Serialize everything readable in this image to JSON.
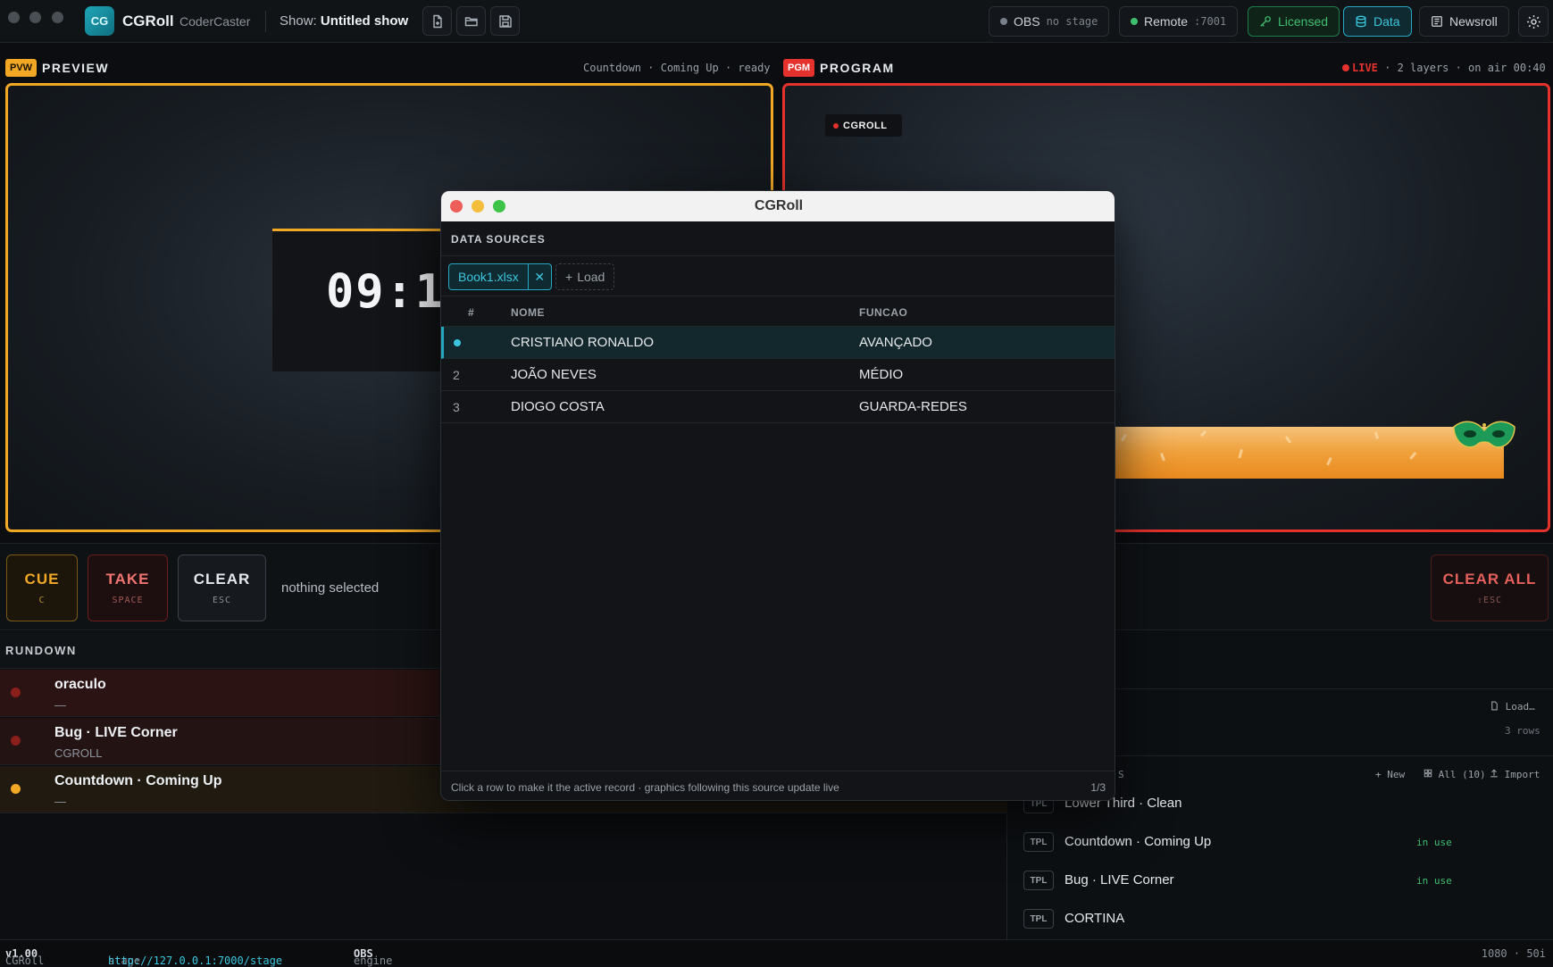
{
  "app": {
    "name": "CGRoll",
    "subtitle": "CoderCaster",
    "logo": "CG",
    "show_label": "Show:",
    "show_name": "Untitled show"
  },
  "toolbar": {
    "obs": {
      "label": "OBS",
      "status": "no stage"
    },
    "remote": {
      "label": "Remote",
      "port": ":7001"
    },
    "licensed": "Licensed",
    "data": "Data",
    "newsroll": "Newsroll"
  },
  "preview": {
    "tag": "PVW",
    "label": "PREVIEW",
    "status": "Countdown · Coming Up · ready",
    "countdown": "09:19"
  },
  "program": {
    "tag": "PGM",
    "label": "PROGRAM",
    "live": "LIVE",
    "status": "· 2 layers · on air 00:40",
    "bug_text": "CGROLL"
  },
  "controls": {
    "cue": {
      "label": "CUE",
      "key": "C"
    },
    "take": {
      "label": "TAKE",
      "key": "SPACE"
    },
    "clear": {
      "label": "CLEAR",
      "key": "ESC"
    },
    "clear_all": {
      "label": "CLEAR ALL",
      "key": "⇧ESC"
    },
    "selection": "nothing selected"
  },
  "rundown": {
    "title": "RUNDOWN",
    "items": [
      {
        "name": "oraculo",
        "sub": "—"
      },
      {
        "name": "Bug · LIVE Corner",
        "sub": "CGROLL"
      },
      {
        "name": "Countdown · Coming Up",
        "sub": "—"
      }
    ]
  },
  "right_panel": {
    "load": "Load…",
    "rows": "3 rows",
    "templates_suffix": "S",
    "new": "New",
    "all": "All (10)",
    "import": "Import",
    "templates": [
      {
        "badge": "TPL",
        "name": "Lower Third · Clean",
        "status": ""
      },
      {
        "badge": "TPL",
        "name": "Countdown · Coming Up",
        "status": "in use"
      },
      {
        "badge": "TPL",
        "name": "Bug · LIVE Corner",
        "status": "in use"
      },
      {
        "badge": "TPL",
        "name": "CORTINA",
        "status": ""
      }
    ]
  },
  "statusbar": {
    "app": "CGRoll",
    "version": "v1.00",
    "stage_label": "stage",
    "stage_url": "http://127.0.0.1:7000/stage",
    "engine_label": "engine",
    "engine": "OBS",
    "format": "1080 · 50i"
  },
  "modal": {
    "title": "CGRoll",
    "section": "DATA SOURCES",
    "file_tab": "Book1.xlsx",
    "load_btn": "Load",
    "columns": [
      "#",
      "NOME",
      "FUNCAO"
    ],
    "rows": [
      {
        "index": "",
        "nome": "CRISTIANO RONALDO",
        "funcao": "AVANÇADO",
        "active": true
      },
      {
        "index": "2",
        "nome": "JOÃO NEVES",
        "funcao": "MÉDIO",
        "active": false
      },
      {
        "index": "3",
        "nome": "DIOGO COSTA",
        "funcao": "GUARDA-REDES",
        "active": false
      }
    ],
    "hint": "Click a row to make it the active record · graphics following this source update live",
    "count": "1/3"
  },
  "colors": {
    "preview": "#f2a825",
    "program": "#e5322d",
    "accent": "#23a9c2",
    "licensed": "#3fbf6f"
  }
}
